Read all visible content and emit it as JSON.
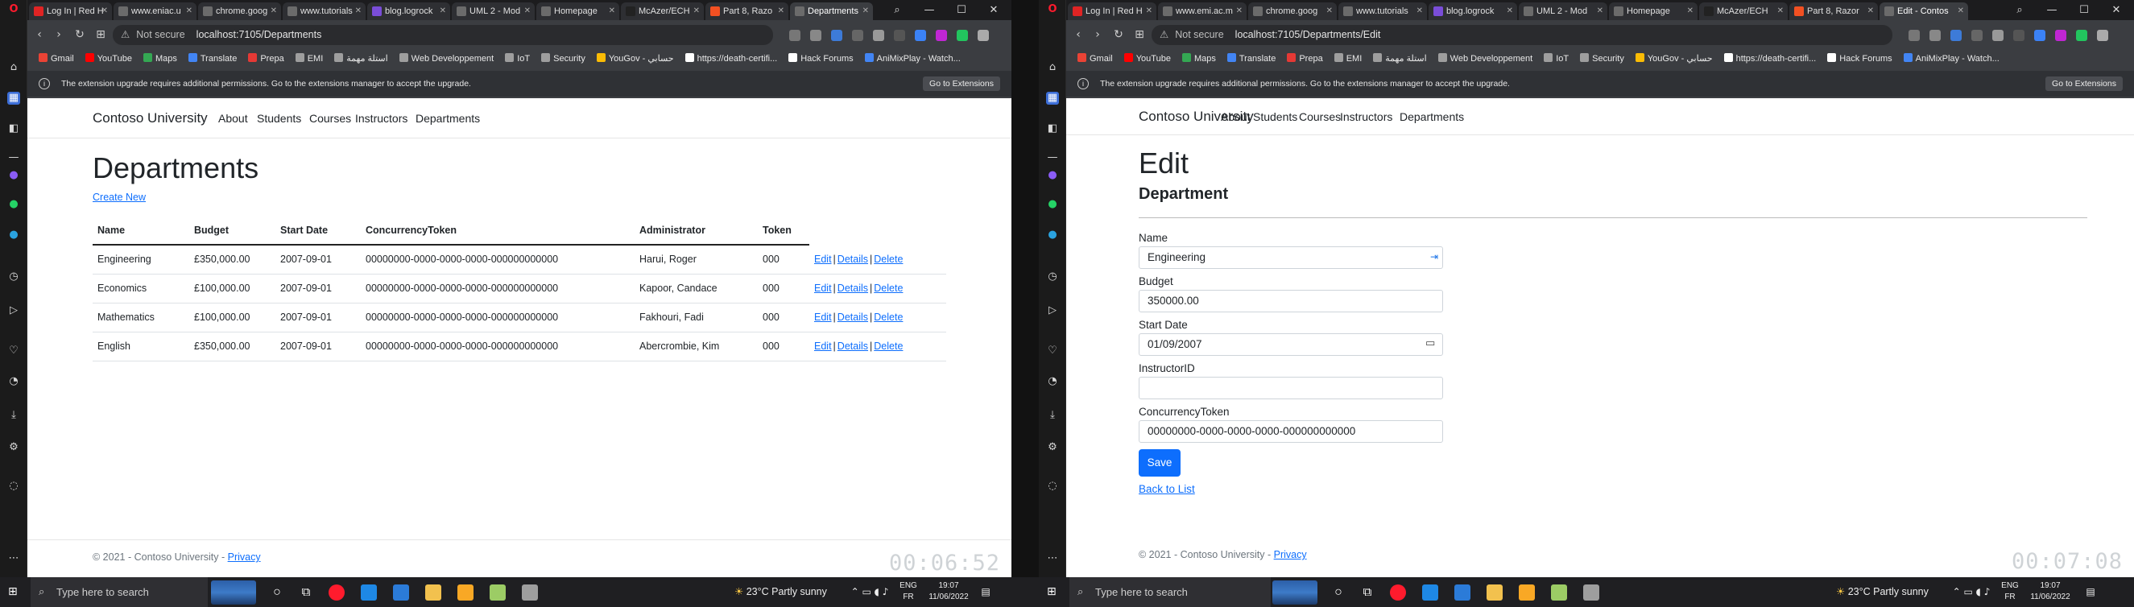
{
  "left": {
    "tabs": [
      {
        "label": "Log In | Red H",
        "icon_color": "#e02424"
      },
      {
        "label": "www.eniac.u",
        "icon_color": "#6b6b6b"
      },
      {
        "label": "chrome.goog",
        "icon_color": "#6b6b6b"
      },
      {
        "label": "www.tutorials",
        "icon_color": "#6b6b6b"
      },
      {
        "label": "blog.logrock",
        "icon_color": "#7a4dd8"
      },
      {
        "label": "UML 2 - Mod",
        "icon_color": "#6b6b6b"
      },
      {
        "label": "Homepage",
        "icon_color": "#6b6b6b"
      },
      {
        "label": "McAzer/ECH",
        "icon_color": "#222222"
      },
      {
        "label": "Part 8, Razo",
        "icon_color": "#f25022"
      },
      {
        "label": "Departments",
        "icon_color": "#6b6b6b"
      }
    ],
    "url_warning": "⚠",
    "not_secure": "Not secure",
    "url": "localhost:7105/Departments",
    "bookmarks": [
      {
        "label": "Gmail",
        "color": "#ea4335"
      },
      {
        "label": "YouTube",
        "color": "#ff0000"
      },
      {
        "label": "Maps",
        "color": "#34a853"
      },
      {
        "label": "Translate",
        "color": "#4285f4"
      },
      {
        "label": "Prepa",
        "color": "#e53935"
      },
      {
        "label": "EMI",
        "color": "#9e9e9e"
      },
      {
        "label": "استلة مهمة",
        "color": "#9e9e9e"
      },
      {
        "label": "Web Developpement",
        "color": "#9e9e9e"
      },
      {
        "label": "IoT",
        "color": "#9e9e9e"
      },
      {
        "label": "Security",
        "color": "#9e9e9e"
      },
      {
        "label": "YouGov - حسابي",
        "color": "#fbbc05"
      },
      {
        "label": "https://death-certifi...",
        "color": "#ffffff"
      },
      {
        "label": "Hack Forums",
        "color": "#ffffff"
      },
      {
        "label": "AniMixPlay - Watch...",
        "color": "#4285f4"
      }
    ],
    "notice": "The extension upgrade requires additional permissions. Go to the extensions manager to accept the upgrade.",
    "notice_button": "Go to Extensions",
    "brand": "Contoso University",
    "nav": [
      "About",
      "Students",
      "Courses",
      "Instructors",
      "Departments"
    ],
    "title": "Departments",
    "create_new": "Create New",
    "columns": [
      "Name",
      "Budget",
      "Start Date",
      "ConcurrencyToken",
      "Administrator",
      "Token"
    ],
    "rows": [
      {
        "name": "Engineering",
        "budget": "£350,000.00",
        "start": "2007-09-01",
        "token": "00000000-0000-0000-0000-000000000000",
        "admin": "Harui, Roger",
        "tok": "000"
      },
      {
        "name": "Economics",
        "budget": "£100,000.00",
        "start": "2007-09-01",
        "token": "00000000-0000-0000-0000-000000000000",
        "admin": "Kapoor, Candace",
        "tok": "000"
      },
      {
        "name": "Mathematics",
        "budget": "£100,000.00",
        "start": "2007-09-01",
        "token": "00000000-0000-0000-0000-000000000000",
        "admin": "Fakhouri, Fadi",
        "tok": "000"
      },
      {
        "name": "English",
        "budget": "£350,000.00",
        "start": "2007-09-01",
        "token": "00000000-0000-0000-0000-000000000000",
        "admin": "Abercrombie, Kim",
        "tok": "000"
      }
    ],
    "actions": {
      "edit": "Edit",
      "details": "Details",
      "delete": "Delete",
      "sep": "|"
    },
    "footer_text": "© 2021 - Contoso University - ",
    "footer_link": "Privacy",
    "timer": "00:06:52",
    "taskbar": {
      "search": "Type here to search",
      "weather": "23°C  Partly sunny",
      "lang": "ENG",
      "lang2": "FR",
      "time": "19:07",
      "date": "11/06/2022"
    }
  },
  "right": {
    "tabs": [
      {
        "label": "Log In | Red H",
        "icon_color": "#e02424"
      },
      {
        "label": "www.emi.ac.m",
        "icon_color": "#6b6b6b"
      },
      {
        "label": "chrome.goog",
        "icon_color": "#6b6b6b"
      },
      {
        "label": "www.tutorials",
        "icon_color": "#6b6b6b"
      },
      {
        "label": "blog.logrock",
        "icon_color": "#7a4dd8"
      },
      {
        "label": "UML 2 - Mod",
        "icon_color": "#6b6b6b"
      },
      {
        "label": "Homepage",
        "icon_color": "#6b6b6b"
      },
      {
        "label": "McAzer/ECH",
        "icon_color": "#222222"
      },
      {
        "label": "Part 8, Razor",
        "icon_color": "#f25022"
      },
      {
        "label": "Edit - Contos",
        "icon_color": "#6b6b6b"
      }
    ],
    "url_warning": "⚠",
    "not_secure": "Not secure",
    "url": "localhost:7105/Departments/Edit",
    "notice": "The extension upgrade requires additional permissions. Go to the extensions manager to accept the upgrade.",
    "notice_button": "Go to Extensions",
    "brand": "Contoso University",
    "nav": [
      "About",
      "Students",
      "Courses",
      "Instructors",
      "Departments"
    ],
    "title": "Edit",
    "subtitle": "Department",
    "fields": {
      "name_label": "Name",
      "name_value": "Engineering",
      "budget_label": "Budget",
      "budget_value": "350000.00",
      "start_label": "Start Date",
      "start_value": "01/09/2007",
      "instructor_label": "InstructorID",
      "instructor_value": "",
      "token_label": "ConcurrencyToken",
      "token_value": "00000000-0000-0000-0000-000000000000"
    },
    "save": "Save",
    "back": "Back to List",
    "footer_text": "© 2021 - Contoso University - ",
    "footer_link": "Privacy",
    "timer": "00:07:08",
    "taskbar": {
      "search": "Type here to search",
      "weather": "23°C  Partly sunny",
      "lang": "ENG",
      "lang2": "FR",
      "time": "19:07",
      "date": "11/06/2022"
    }
  },
  "colors": {
    "link": "#0d6efd",
    "browser_chrome": "#3b3d41",
    "tab_strip": "#1c1c1e",
    "taskbar": "#1f1f22",
    "save_button": "#0d6efd"
  }
}
